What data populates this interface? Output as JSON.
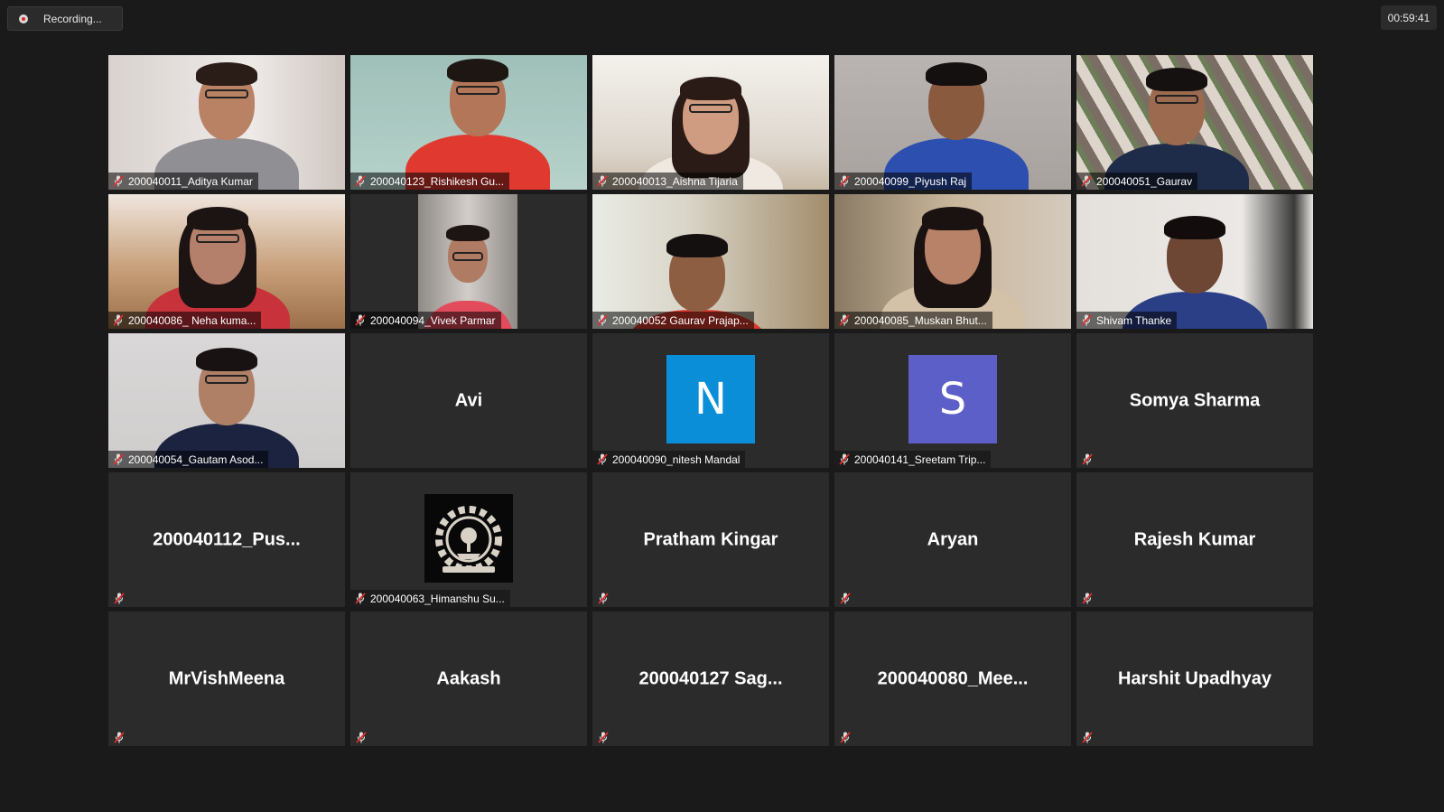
{
  "recording": {
    "label": "Recording..."
  },
  "timer": "00:59:41",
  "participants": [
    {
      "name": "200040011_Aditya Kumar",
      "type": "video",
      "muted": true
    },
    {
      "name": "200040123_Rishikesh Gu...",
      "type": "video",
      "muted": true
    },
    {
      "name": "200040013_Aishna Tijaria",
      "type": "video",
      "muted": true
    },
    {
      "name": "200040099_Piyush Raj",
      "type": "video",
      "muted": true
    },
    {
      "name": "200040051_Gaurav",
      "type": "video",
      "muted": true
    },
    {
      "name": "200040086_ Neha kuma...",
      "type": "video",
      "muted": true
    },
    {
      "name": "200040094_Vivek Parmar",
      "type": "video",
      "muted": true
    },
    {
      "name": "200040052 Gaurav Prajap...",
      "type": "video",
      "muted": true
    },
    {
      "name": "200040085_Muskan Bhut...",
      "type": "video",
      "muted": true
    },
    {
      "name": "Shivam  Thanke",
      "type": "video",
      "muted": true
    },
    {
      "name": "200040054_Gautam Asod...",
      "type": "video",
      "muted": true
    },
    {
      "name": "Avi",
      "type": "name",
      "muted": false
    },
    {
      "name": "200040090_nitesh Mandal",
      "type": "avatar",
      "initial": "N",
      "avatar_color": "#0b8ed8",
      "muted": true
    },
    {
      "name": "200040141_Sreetam Trip...",
      "type": "avatar",
      "initial": "S",
      "avatar_color": "#5b5fc7",
      "muted": true
    },
    {
      "name": "Somya Sharma",
      "type": "name",
      "muted": true
    },
    {
      "name": "200040112_Pus...",
      "type": "name",
      "muted": true
    },
    {
      "name": "200040063_Himanshu Su...",
      "type": "logo",
      "muted": true
    },
    {
      "name": "Pratham Kingar",
      "type": "name",
      "muted": true
    },
    {
      "name": "Aryan",
      "type": "name",
      "muted": true
    },
    {
      "name": "Rajesh Kumar",
      "type": "name",
      "muted": true
    },
    {
      "name": "MrVishMeena",
      "type": "name",
      "muted": true
    },
    {
      "name": "Aakash",
      "type": "name",
      "muted": true
    },
    {
      "name": "200040127  Sag...",
      "type": "name",
      "muted": true
    },
    {
      "name": "200040080_Mee...",
      "type": "name",
      "muted": true
    },
    {
      "name": "Harshit Upadhyay",
      "type": "name",
      "muted": true
    }
  ]
}
